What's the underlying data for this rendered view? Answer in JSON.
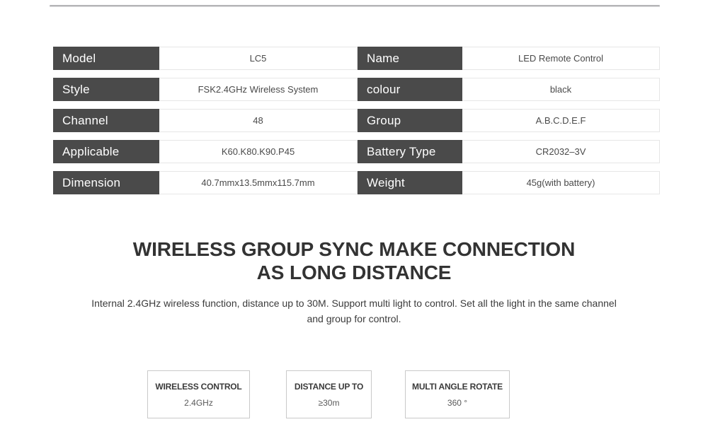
{
  "divider": {
    "name": "top-horizontal-rule",
    "color": "#b4b4b6"
  },
  "spec_table": {
    "rows": [
      {
        "label_left": "Model",
        "value_left": "LC5",
        "label_right": "Name",
        "value_right": "LED Remote Control"
      },
      {
        "label_left": "Style",
        "value_left": "FSK2.4GHz Wireless System",
        "label_right": "colour",
        "value_right": "black"
      },
      {
        "label_left": "Channel",
        "value_left": "48",
        "label_right": "Group",
        "value_right": "A.B.C.D.E.F"
      },
      {
        "label_left": "Applicable",
        "value_left": "K60.K80.K90.P45",
        "label_right": "Battery Type",
        "value_right": "CR2032–3V"
      },
      {
        "label_left": "Dimension",
        "value_left": "40.7mmx13.5mmx115.7mm",
        "label_right": "Weight",
        "value_right": "45g(with battery)"
      }
    ],
    "label_bg": "#4a4a4a",
    "label_color": "#ffffff",
    "value_bg": "#ffffff",
    "value_color": "#4a4a4a"
  },
  "headline": {
    "line1": "WIRELESS GROUP SYNC MAKE CONNECTION",
    "line2": "AS LONG DISTANCE"
  },
  "subcopy": {
    "text": "Internal 2.4GHz wireless function, distance up to 30M. Support multi light to control. Set all the light in the same channel and group for control."
  },
  "features": [
    {
      "title": "WIRELESS CONTROL",
      "value": "2.4GHz"
    },
    {
      "title": "DISTANCE UP TO",
      "value": "≥30m"
    },
    {
      "title": "MULTI ANGLE ROTATE",
      "value": "360 °"
    }
  ]
}
